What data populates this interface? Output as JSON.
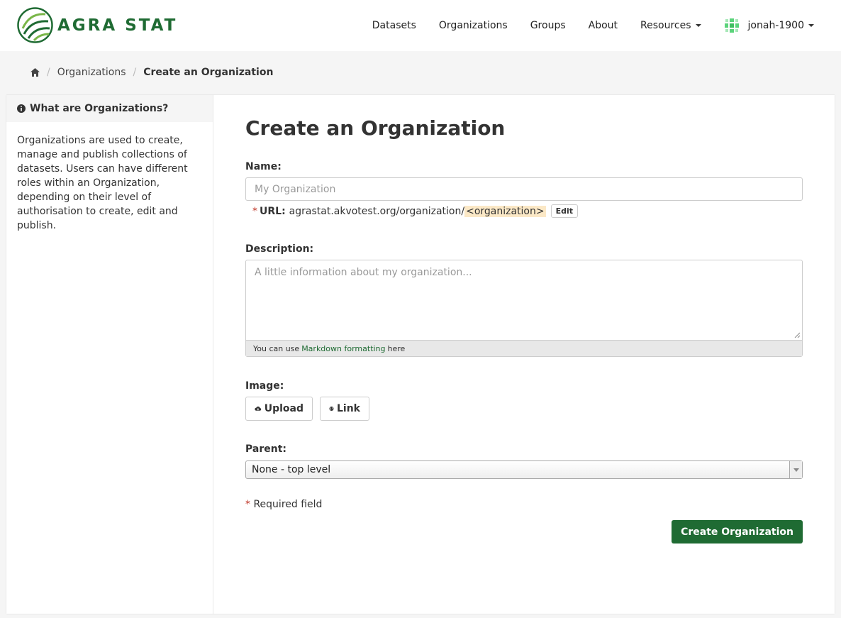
{
  "brand": {
    "name": "AGRA STAT",
    "color": "#1f6b33"
  },
  "nav": {
    "items": [
      {
        "label": "Datasets"
      },
      {
        "label": "Organizations"
      },
      {
        "label": "Groups"
      },
      {
        "label": "About"
      },
      {
        "label": "Resources"
      }
    ],
    "user": "jonah-1900"
  },
  "breadcrumb": {
    "home_icon": "home-icon",
    "items": [
      "Organizations",
      "Create an Organization"
    ]
  },
  "sidebar": {
    "title": "What are Organizations?",
    "body": "Organizations are used to create, manage and publish collections of datasets. Users can have different roles within an Organization, depending on their level of authorisation to create, edit and publish."
  },
  "form": {
    "title": "Create an Organization",
    "name_label": "Name:",
    "name_placeholder": "My Organization",
    "url_required": "*",
    "url_label": "URL:",
    "url_prefix": "agrastat.akvotest.org/organization/",
    "url_slug": "<organization>",
    "url_edit": "Edit",
    "description_label": "Description:",
    "description_placeholder": "A little information about my organization...",
    "markdown_prefix": "You can use",
    "markdown_link": "Markdown formatting",
    "markdown_suffix": "here",
    "image_label": "Image:",
    "upload_label": "Upload",
    "link_label": "Link",
    "parent_label": "Parent:",
    "parent_value": "None - top level",
    "required_mark": "*",
    "required_text": "Required field",
    "submit_label": "Create Organization"
  }
}
